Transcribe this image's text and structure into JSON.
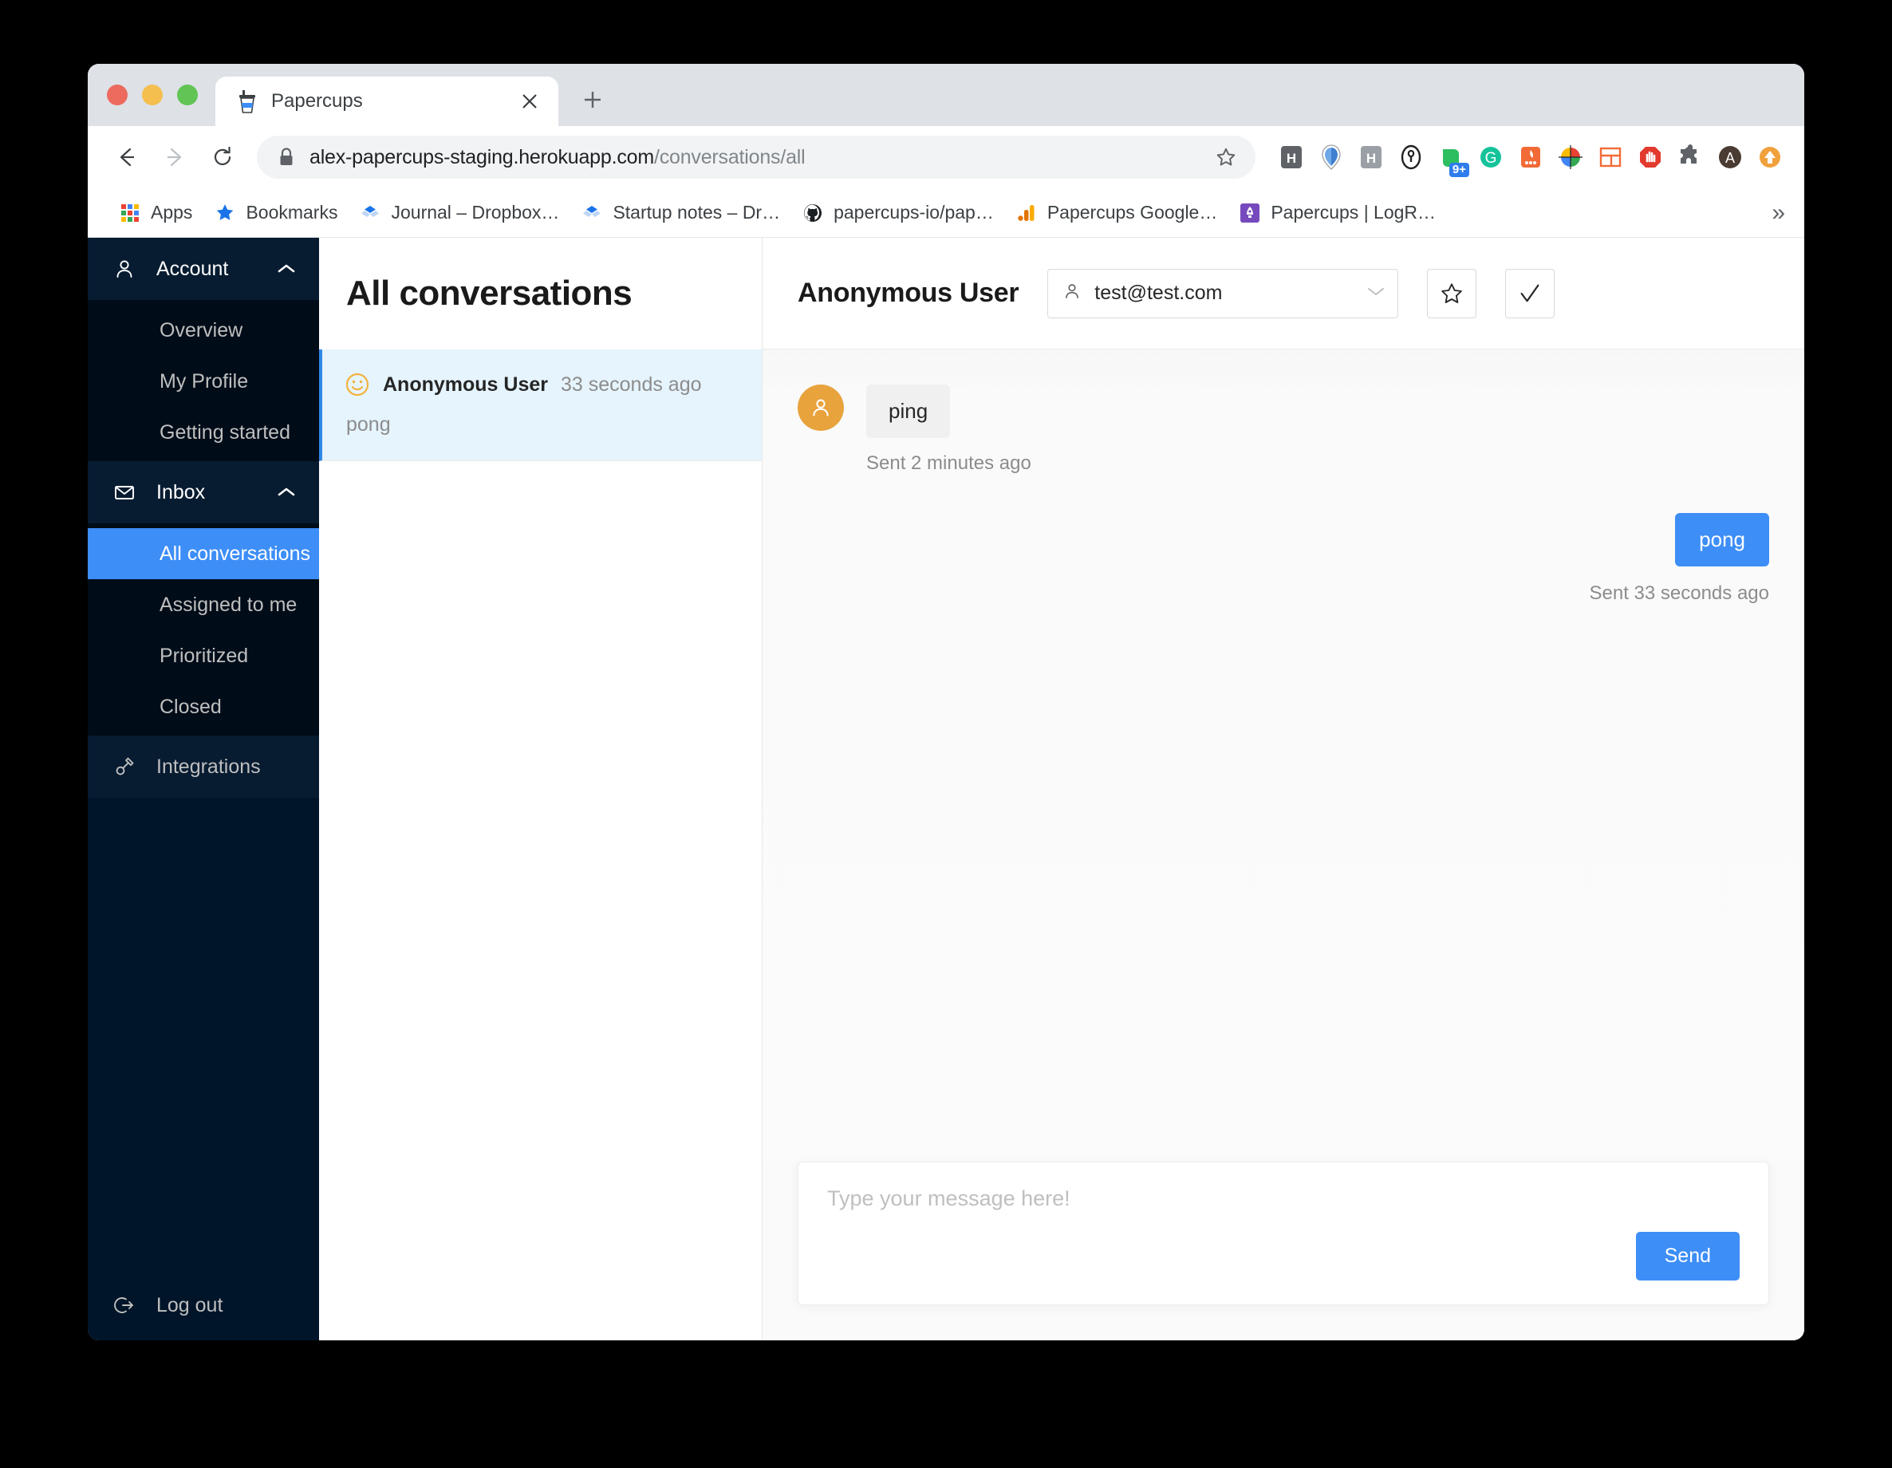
{
  "browser": {
    "tab": {
      "title": "Papercups",
      "favicon": "papercup-icon",
      "close": "×"
    },
    "new_tab_label": "+",
    "nav": {
      "back": "back-arrow-icon",
      "forward": "forward-arrow-icon",
      "reload": "reload-icon"
    },
    "omnibox": {
      "lock": "lock-icon",
      "url_domain": "alex-papercups-staging.herokuapp.com",
      "url_path": "/conversations/all",
      "star": "star-icon"
    },
    "extensions": [
      {
        "name": "hubspot-extension",
        "letter": "H",
        "color": "#5f6368"
      },
      {
        "name": "honey-extension",
        "letter": "",
        "color": "#3f7fd0"
      },
      {
        "name": "hubspot-sales-extension",
        "letter": "H",
        "color": "#9aa0a6"
      },
      {
        "name": "onepassword-extension",
        "letter": "",
        "color": "#222222"
      },
      {
        "name": "evernote-extension",
        "letter": "",
        "color": "#2dbe60",
        "badge": "9+"
      },
      {
        "name": "grammarly-extension",
        "letter": "G",
        "color": "#15c39a"
      },
      {
        "name": "firebase-extension",
        "letter": "",
        "color": "#f26b37"
      },
      {
        "name": "colorpick-eyedropper-extension",
        "letter": "",
        "color": "#4285f4"
      },
      {
        "name": "window-resizer-extension",
        "letter": "",
        "color": "#f26b37"
      },
      {
        "name": "adblock-extension",
        "letter": "",
        "color": "#e23a2e"
      },
      {
        "name": "puzzle-extensions-menu",
        "letter": "",
        "color": "#5f6368"
      },
      {
        "name": "profile-avatar",
        "letter": "A",
        "color": "#4a3b33"
      },
      {
        "name": "update-available-icon",
        "letter": "",
        "color": "#f0a13c"
      }
    ],
    "bookmarks": [
      {
        "label": "Apps",
        "icon": "apps-grid-icon"
      },
      {
        "label": "Bookmarks",
        "icon": "star-icon"
      },
      {
        "label": "Journal – Dropbox…",
        "icon": "dropbox-icon"
      },
      {
        "label": "Startup notes – Dr…",
        "icon": "dropbox-icon"
      },
      {
        "label": "papercups-io/pap…",
        "icon": "github-icon"
      },
      {
        "label": "Papercups Google…",
        "icon": "google-analytics-icon"
      },
      {
        "label": "Papercups | LogR…",
        "icon": "logrocket-icon"
      }
    ],
    "bookmarks_overflow": "»"
  },
  "sidebar": {
    "groups": [
      {
        "label": "Account",
        "icon": "user-icon",
        "chevron": "chevron-up-icon",
        "items": [
          {
            "label": "Overview",
            "active": false
          },
          {
            "label": "My Profile",
            "active": false
          },
          {
            "label": "Getting started",
            "active": false
          }
        ]
      },
      {
        "label": "Inbox",
        "icon": "mail-icon",
        "chevron": "chevron-up-icon",
        "items": [
          {
            "label": "All conversations",
            "active": true
          },
          {
            "label": "Assigned to me",
            "active": false
          },
          {
            "label": "Prioritized",
            "active": false
          },
          {
            "label": "Closed",
            "active": false
          }
        ]
      }
    ],
    "integrations": {
      "label": "Integrations",
      "icon": "api-plug-icon"
    },
    "logout": {
      "label": "Log out",
      "icon": "logout-icon"
    },
    "accent_color": "#3d8ef7",
    "bg_color": "#001529"
  },
  "conversation_list": {
    "title": "All conversations",
    "items": [
      {
        "icon": "smiley-face-icon",
        "name": "Anonymous User",
        "time": "33 seconds ago",
        "preview": "pong",
        "selected": true
      }
    ]
  },
  "chat": {
    "title": "Anonymous User",
    "assignee": {
      "icon": "user-icon",
      "value": "test@test.com",
      "chevron": "chevron-down-icon"
    },
    "star_button": "star-icon",
    "close_button": "check-icon",
    "messages": [
      {
        "direction": "incoming",
        "avatar": "user-avatar",
        "text": "ping",
        "sent_label": "Sent 2 minutes ago"
      },
      {
        "direction": "outgoing",
        "text": "pong",
        "sent_label": "Sent 33 seconds ago"
      }
    ],
    "composer": {
      "placeholder": "Type your message here!",
      "value": "",
      "send_label": "Send"
    }
  }
}
